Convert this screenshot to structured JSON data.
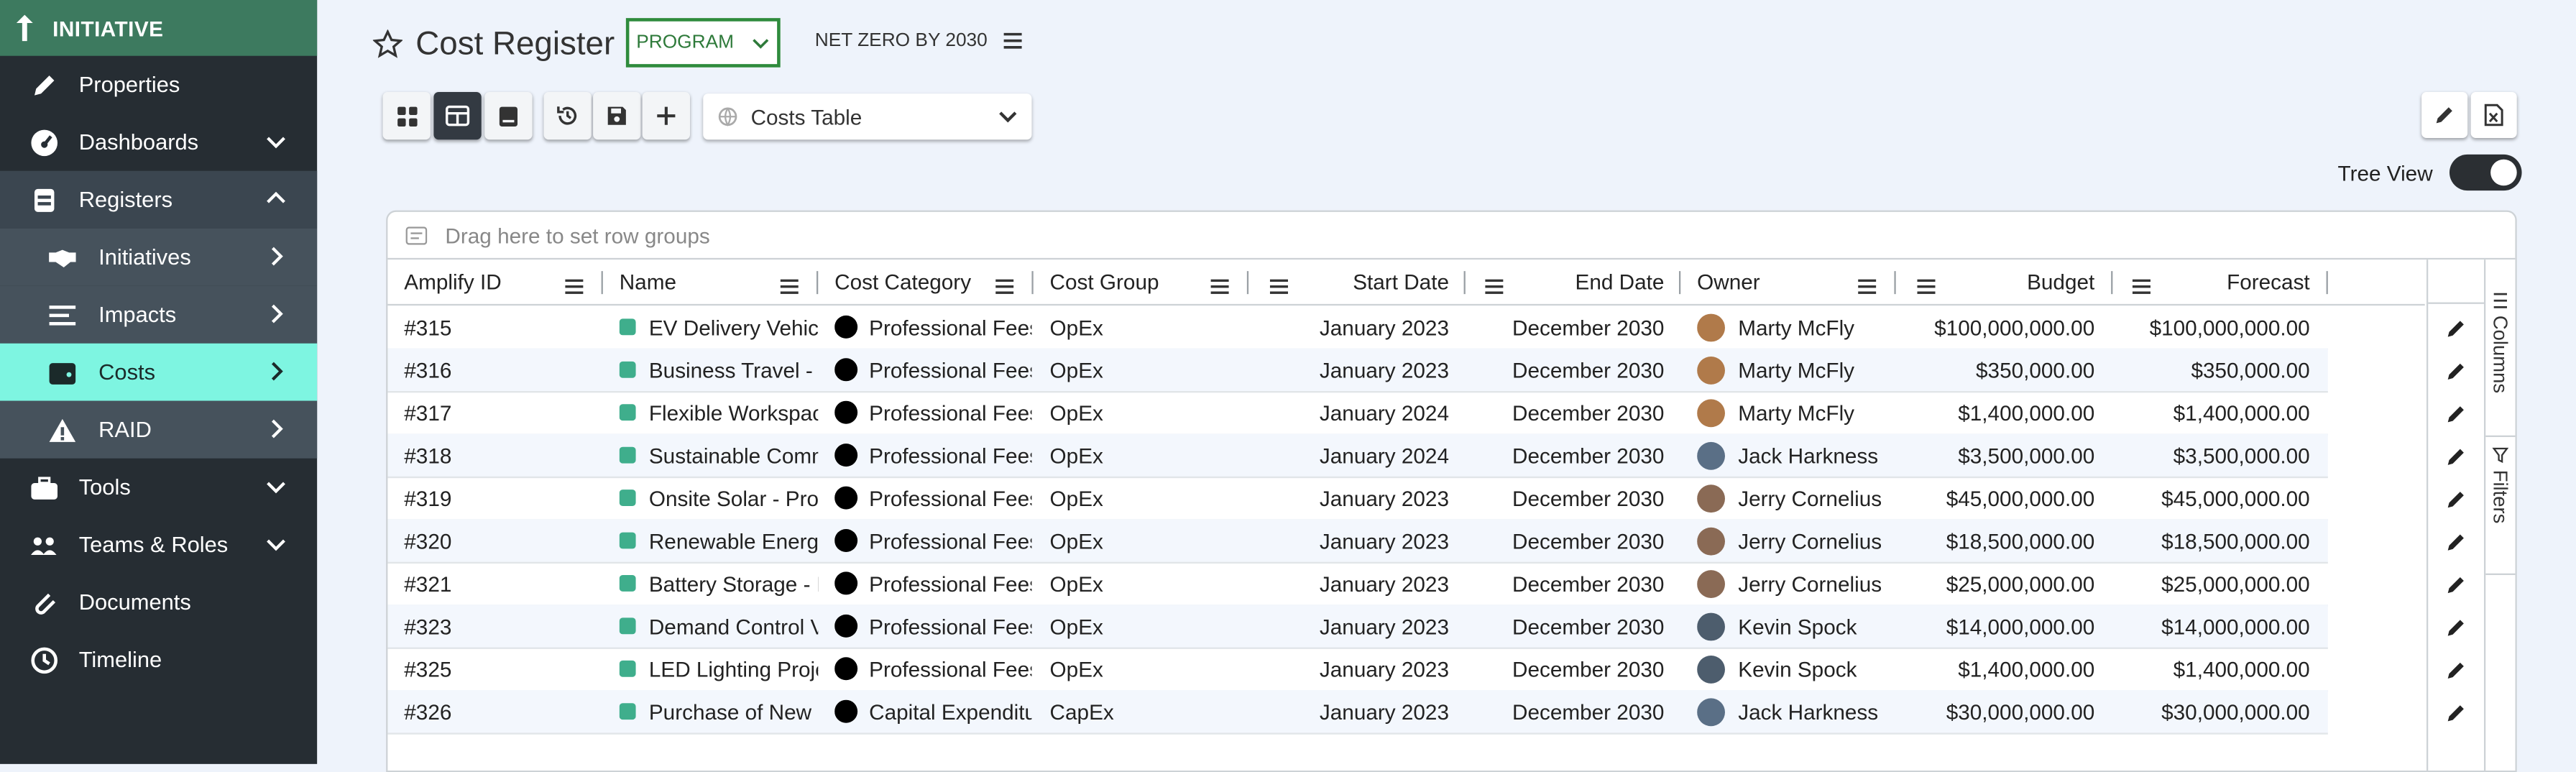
{
  "sidebar": {
    "header": "INITIATIVE",
    "items": [
      {
        "label": "Properties"
      },
      {
        "label": "Dashboards"
      },
      {
        "label": "Registers"
      },
      {
        "label": "Initiatives"
      },
      {
        "label": "Impacts"
      },
      {
        "label": "Costs"
      },
      {
        "label": "RAID"
      },
      {
        "label": "Tools"
      },
      {
        "label": "Teams & Roles"
      },
      {
        "label": "Documents"
      },
      {
        "label": "Timeline"
      }
    ]
  },
  "header": {
    "title": "Cost Register",
    "program_button": "PROGRAM",
    "context_label": "NET ZERO BY 2030"
  },
  "toolbar": {
    "view_select": "Costs Table",
    "tree_view_label": "Tree View"
  },
  "grid": {
    "group_placeholder": "Drag here to set row groups",
    "columns": [
      "Amplify ID",
      "Name",
      "Cost Category",
      "Cost Group",
      "Start Date",
      "End Date",
      "Owner",
      "Budget",
      "Forecast"
    ],
    "rows": [
      {
        "id": "#315",
        "name": "EV Delivery Vehicle",
        "category": "Professional Fees",
        "group": "OpEx",
        "start": "January 2023",
        "end": "December 2030",
        "owner": "Marty McFly",
        "budget": "$100,000,000.00",
        "forecast": "$100,000,000.00"
      },
      {
        "id": "#316",
        "name": "Business Travel - F",
        "category": "Professional Fees",
        "group": "OpEx",
        "start": "January 2023",
        "end": "December 2030",
        "owner": "Marty McFly",
        "budget": "$350,000.00",
        "forecast": "$350,000.00"
      },
      {
        "id": "#317",
        "name": "Flexible Workspac",
        "category": "Professional Fees",
        "group": "OpEx",
        "start": "January 2024",
        "end": "December 2030",
        "owner": "Marty McFly",
        "budget": "$1,400,000.00",
        "forecast": "$1,400,000.00"
      },
      {
        "id": "#318",
        "name": "Sustainable Comm",
        "category": "Professional Fees",
        "group": "OpEx",
        "start": "January 2024",
        "end": "December 2030",
        "owner": "Jack Harkness",
        "budget": "$3,500,000.00",
        "forecast": "$3,500,000.00"
      },
      {
        "id": "#319",
        "name": "Onsite Solar - Prof",
        "category": "Professional Fees",
        "group": "OpEx",
        "start": "January 2023",
        "end": "December 2030",
        "owner": "Jerry Cornelius",
        "budget": "$45,000,000.00",
        "forecast": "$45,000,000.00"
      },
      {
        "id": "#320",
        "name": "Renewable Energy",
        "category": "Professional Fees",
        "group": "OpEx",
        "start": "January 2023",
        "end": "December 2030",
        "owner": "Jerry Cornelius",
        "budget": "$18,500,000.00",
        "forecast": "$18,500,000.00"
      },
      {
        "id": "#321",
        "name": "Battery Storage - F",
        "category": "Professional Fees",
        "group": "OpEx",
        "start": "January 2023",
        "end": "December 2030",
        "owner": "Jerry Cornelius",
        "budget": "$25,000,000.00",
        "forecast": "$25,000,000.00"
      },
      {
        "id": "#323",
        "name": "Demand Control V",
        "category": "Professional Fees",
        "group": "OpEx",
        "start": "January 2023",
        "end": "December 2030",
        "owner": "Kevin Spock",
        "budget": "$14,000,000.00",
        "forecast": "$14,000,000.00"
      },
      {
        "id": "#325",
        "name": "LED Lighting Proje",
        "category": "Professional Fees",
        "group": "OpEx",
        "start": "January 2023",
        "end": "December 2030",
        "owner": "Kevin Spock",
        "budget": "$1,400,000.00",
        "forecast": "$1,400,000.00"
      },
      {
        "id": "#326",
        "name": "Purchase of New C",
        "category": "Capital Expenditu",
        "group": "CapEx",
        "start": "January 2023",
        "end": "December 2030",
        "owner": "Jack Harkness",
        "budget": "$30,000,000.00",
        "forecast": "$30,000,000.00"
      }
    ]
  },
  "side_tabs": {
    "columns": "Columns",
    "filters": "Filters"
  },
  "colors": {
    "sidebar_bg": "#262d33",
    "header_green": "#3d7a5f",
    "active_item": "#7ef5e1",
    "program_border": "#2e8b3c"
  }
}
